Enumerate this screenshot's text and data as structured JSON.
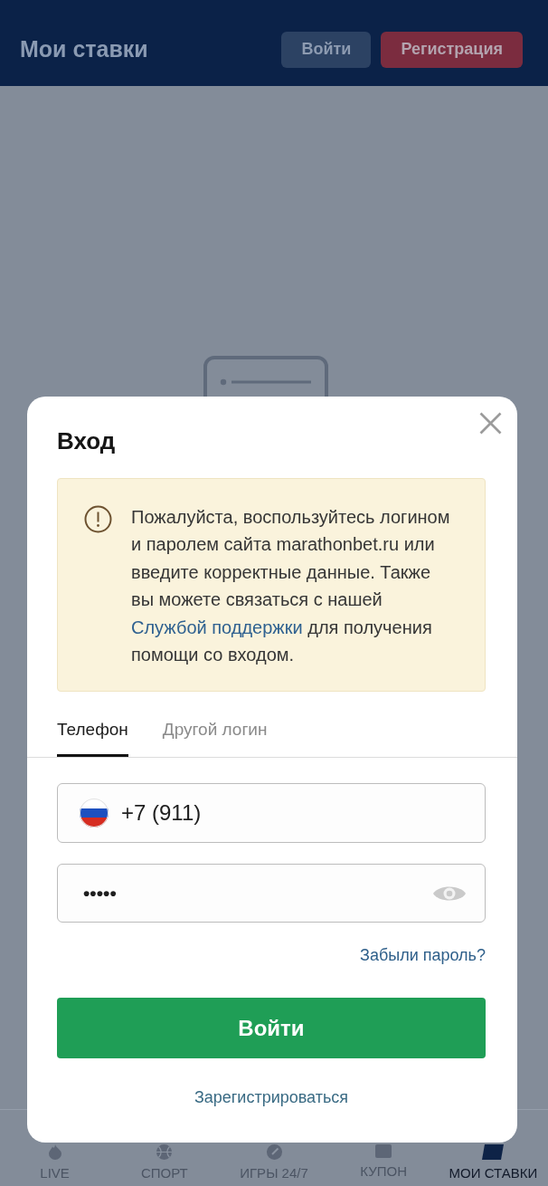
{
  "header": {
    "title": "Мои ставки",
    "buttons": [
      {
        "label": "Войти",
        "kind": "secondary"
      },
      {
        "label": "Регистрация",
        "kind": "accent"
      }
    ]
  },
  "login_dialog": {
    "title": "Вход",
    "notice": {
      "text_before": "Пожалуйста, воспользуйтесь логином и паролем сайта marathonbet.ru или введите корректные данные. Также вы можете связаться с нашей",
      "link": "Службой поддержки",
      "text_after": "для получения помощи со входом."
    },
    "tabs": [
      {
        "label": "Телефон",
        "selected": true
      },
      {
        "label": "Другой логин",
        "selected": false
      }
    ],
    "phone_field": {
      "value": "+7 (911)"
    },
    "password_field": {
      "value": "•••••"
    },
    "forgot_password_link": "Забыли пароль?",
    "submit_button": "Войти",
    "register_link": "Зарегистрироваться"
  },
  "bottom_nav": [
    {
      "label": "LIVE",
      "selected": false
    },
    {
      "label": "СПОРТ",
      "selected": false
    },
    {
      "label": "ИГРЫ 24/7",
      "selected": false
    },
    {
      "label": "КУПОН",
      "selected": false
    },
    {
      "label": "МОИ СТАВКИ",
      "selected": true
    }
  ]
}
